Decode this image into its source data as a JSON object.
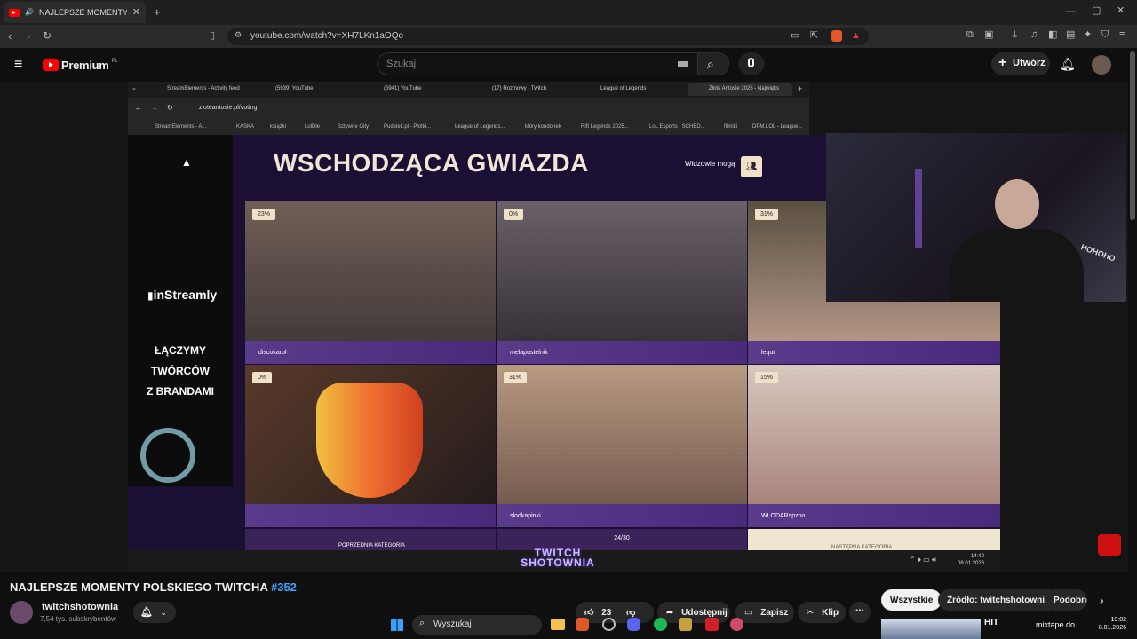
{
  "browser": {
    "active_tab": "NAJLEPSZE MOMENTY POLSKIEGO",
    "url": "youtube.com/watch?v=XH7LKn1aOQo"
  },
  "youtube": {
    "logo": "Premium",
    "logo_region": "PL",
    "search_placeholder": "Szukaj",
    "create_label": "Utwórz"
  },
  "stream": {
    "inner_tabs": [
      "StreamElements - Activity feed",
      "(5939) YouTube",
      "(5941) YouTube",
      "(17) Rozmowy - Twitch",
      "League of Legends",
      "Złote Antosie 2025 - Najwięks"
    ],
    "inner_url": "zloteantosie.pl/voting",
    "bookmarks": [
      "StreamElements - A...",
      "KASKA",
      "książki",
      "LolDle",
      "Sztywne Gity",
      "Pudelek.pl - Plotki...",
      "League of Legends...",
      "który kondonek",
      "Rift Legends 2025...",
      "LoL Esports | SCHED...",
      "filmiki",
      "DPM.LOL - League..."
    ],
    "heading": "WSCHODZĄCA GWIAZDA",
    "viewers_label": "Widzowie mogą",
    "sponsor": "inStreamly",
    "sponsor_tagline": [
      "ŁĄCZYMY",
      "TWÓRCÓW",
      "Z BRANDAMI"
    ],
    "candidates": [
      {
        "name": "discokarol",
        "pct": "23%"
      },
      {
        "name": "melapustelnik",
        "pct": "0%"
      },
      {
        "name": "lequt",
        "pct": "31%"
      },
      {
        "name": "",
        "pct": "0%"
      },
      {
        "name": "slodkapinki",
        "pct": "31%"
      },
      {
        "name": "WLODARspzoo",
        "pct": "15%"
      }
    ],
    "prev_label": "POPRZEDNIA KATEGORIA",
    "next_label": "NASTĘPNA KATEGORIA",
    "counter": "24/30",
    "watermark": "TWITCH SHOTOWNIA",
    "inner_time": "14:40",
    "inner_date": "08.01.2026",
    "cam_text": "HOHOHO"
  },
  "video": {
    "title": "NAJLEPSZE MOMENTY POLSKIEGO TWITCHA",
    "title_tag": "#352",
    "channel": "twitchshotownia",
    "subs": "7,54 tys. subskrybentów",
    "likes": "23",
    "share_label": "Udostępnij",
    "save_label": "Zapisz",
    "clip_label": "Klip",
    "chips": [
      "Wszystkie",
      "Źródło: twitchshotownia",
      "Podobne"
    ]
  },
  "taskbar": {
    "search": "Wyszukaj",
    "time": "19:02",
    "date": "8.01.2026",
    "ticker": "mixtape do",
    "hit": "HIT"
  }
}
